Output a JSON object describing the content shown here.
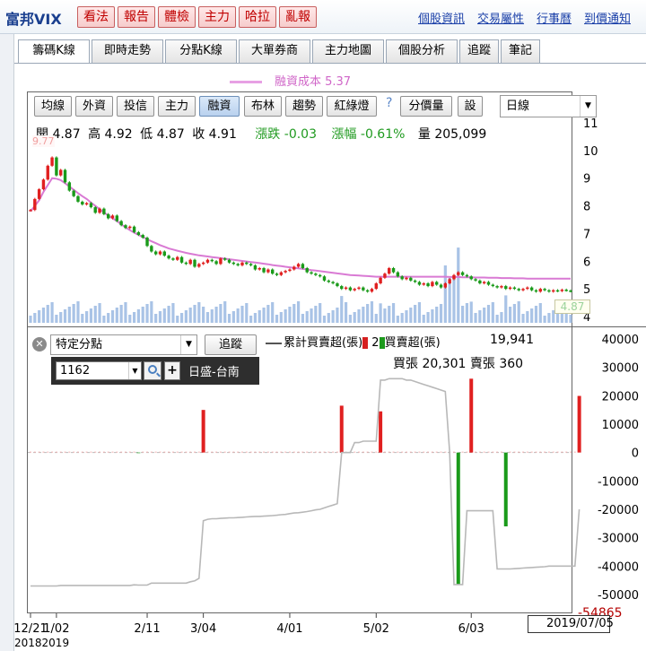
{
  "app": {
    "brand": "富邦VIX",
    "nav_buttons": [
      "看法",
      "報告",
      "體檢",
      "主力",
      "哈拉",
      "亂報"
    ],
    "nav_links": [
      "個股資訊",
      "交易屬性",
      "行事曆",
      "到價通知"
    ],
    "accent_color": "#c00000"
  },
  "tabs": [
    {
      "label": "籌碼K線",
      "active": true
    },
    {
      "label": "即時走勢",
      "active": false
    },
    {
      "label": "分點K線",
      "active": false
    },
    {
      "label": "大單券商",
      "active": false
    },
    {
      "label": "主力地圖",
      "active": false
    },
    {
      "label": "個股分析",
      "active": false
    },
    {
      "label": "追蹤",
      "active": false
    },
    {
      "label": "筆記",
      "active": false
    }
  ],
  "toolbar": {
    "buttons": [
      "均線",
      "外資",
      "投信",
      "主力",
      "融資",
      "布林",
      "趨勢",
      "紅綠燈"
    ],
    "active_button": "融資",
    "help": "?",
    "extra_buttons": [
      "分價量",
      "設"
    ],
    "period": "日線"
  },
  "legend": {
    "margin_cost": "融資成本 5.37",
    "margin_color": "#e7a0e4"
  },
  "ohlc": {
    "open": "開 4.87",
    "high": "高 4.92",
    "low": "低 4.87",
    "close": "收 4.91",
    "change": "漲跌 -0.03",
    "change_pct": "漲幅 -0.61%",
    "volume": "量 205,099"
  },
  "price_markers": {
    "high_mark": "9.77",
    "last_price": "4.87"
  },
  "broker": {
    "close_icon": "✕",
    "selector": "特定分點",
    "track_button": "追蹤",
    "code": "1162",
    "name": "日盛-台南",
    "legend_line": "累計買賣超(張)",
    "legend_bars": "買賣超(張)",
    "legend_num": "2",
    "net": "19,941",
    "buy": "買張 20,301",
    "sell": "賣張 360"
  },
  "axes": {
    "x_tick_labels": [
      "12/21",
      "1/02",
      "2/11",
      "3/04",
      "4/01",
      "5/02",
      "6/03"
    ],
    "date_box": "2019/07/05",
    "year_label": "20182019",
    "min_label": "-54865"
  },
  "chart_data": [
    {
      "type": "candlestick",
      "title": "",
      "x": [
        "2018-12-21",
        "2018-12-24",
        "2018-12-25",
        "2018-12-26",
        "2018-12-27",
        "2018-12-28",
        "2019-01-02",
        "2019-01-03",
        "2019-01-04",
        "2019-01-07",
        "2019-01-08",
        "2019-01-09",
        "2019-01-10",
        "2019-01-11",
        "2019-01-14",
        "2019-01-15",
        "2019-01-16",
        "2019-01-17",
        "2019-01-18",
        "2019-01-21",
        "2019-01-22",
        "2019-01-23",
        "2019-01-24",
        "2019-01-25",
        "2019-01-28",
        "2019-01-29",
        "2019-01-30",
        "2019-02-11",
        "2019-02-12",
        "2019-02-13",
        "2019-02-14",
        "2019-02-15",
        "2019-02-18",
        "2019-02-19",
        "2019-02-20",
        "2019-02-21",
        "2019-02-22",
        "2019-02-25",
        "2019-02-26",
        "2019-02-27",
        "2019-03-04",
        "2019-03-05",
        "2019-03-06",
        "2019-03-07",
        "2019-03-08",
        "2019-03-11",
        "2019-03-12",
        "2019-03-13",
        "2019-03-14",
        "2019-03-15",
        "2019-03-18",
        "2019-03-19",
        "2019-03-20",
        "2019-03-21",
        "2019-03-22",
        "2019-03-25",
        "2019-03-26",
        "2019-03-27",
        "2019-03-28",
        "2019-03-29",
        "2019-04-01",
        "2019-04-02",
        "2019-04-03",
        "2019-04-08",
        "2019-04-09",
        "2019-04-10",
        "2019-04-11",
        "2019-04-12",
        "2019-04-15",
        "2019-04-16",
        "2019-04-17",
        "2019-04-18",
        "2019-04-19",
        "2019-04-22",
        "2019-04-23",
        "2019-04-24",
        "2019-04-25",
        "2019-04-26",
        "2019-04-29",
        "2019-04-30",
        "2019-05-02",
        "2019-05-03",
        "2019-05-06",
        "2019-05-07",
        "2019-05-08",
        "2019-05-09",
        "2019-05-10",
        "2019-05-13",
        "2019-05-14",
        "2019-05-15",
        "2019-05-16",
        "2019-05-17",
        "2019-05-20",
        "2019-05-21",
        "2019-05-22",
        "2019-05-23",
        "2019-05-24",
        "2019-05-27",
        "2019-05-28",
        "2019-05-29",
        "2019-05-30",
        "2019-05-31",
        "2019-06-03",
        "2019-06-04",
        "2019-06-05",
        "2019-06-06",
        "2019-06-10",
        "2019-06-11",
        "2019-06-12",
        "2019-06-13",
        "2019-06-14",
        "2019-06-17",
        "2019-06-18",
        "2019-06-19",
        "2019-06-20",
        "2019-06-21",
        "2019-06-24",
        "2019-06-25",
        "2019-06-26",
        "2019-06-27",
        "2019-06-28",
        "2019-07-01",
        "2019-07-02",
        "2019-07-03",
        "2019-07-04",
        "2019-07-05"
      ],
      "close": [
        7.85,
        8.25,
        8.6,
        8.95,
        9.45,
        9.75,
        9.1,
        9.3,
        8.85,
        8.55,
        8.35,
        8.15,
        8.05,
        8.1,
        7.95,
        7.75,
        7.9,
        7.7,
        7.55,
        7.65,
        7.45,
        7.3,
        7.2,
        7.25,
        7.05,
        6.95,
        6.85,
        6.55,
        6.35,
        6.25,
        6.35,
        6.2,
        6.1,
        6.05,
        6.15,
        5.95,
        5.9,
        6.05,
        5.8,
        5.9,
        5.95,
        6.05,
        6.0,
        5.9,
        6.1,
        6.05,
        5.95,
        5.9,
        5.85,
        5.95,
        5.9,
        5.85,
        5.7,
        5.75,
        5.6,
        5.7,
        5.55,
        5.5,
        5.6,
        5.65,
        5.7,
        5.8,
        5.9,
        5.75,
        5.6,
        5.55,
        5.5,
        5.45,
        5.3,
        5.25,
        5.2,
        5.1,
        5.0,
        5.05,
        4.95,
        5.0,
        5.05,
        4.95,
        4.9,
        5.0,
        5.2,
        5.4,
        5.55,
        5.75,
        5.6,
        5.45,
        5.35,
        5.4,
        5.3,
        5.25,
        5.15,
        5.2,
        5.1,
        5.25,
        5.15,
        5.05,
        5.2,
        5.35,
        5.5,
        5.6,
        5.5,
        5.45,
        5.35,
        5.3,
        5.2,
        5.25,
        5.15,
        5.1,
        5.05,
        5.1,
        5.0,
        5.05,
        5.0,
        4.95,
        5.0,
        5.05,
        4.95,
        4.9,
        5.0,
        4.95,
        4.9,
        4.95,
        4.92,
        4.97,
        4.94,
        4.91
      ],
      "margin_cost": [
        7.8,
        8.0,
        8.2,
        8.5,
        8.75,
        9.0,
        8.98,
        8.93,
        8.82,
        8.7,
        8.58,
        8.46,
        8.35,
        8.25,
        8.12,
        8.0,
        7.88,
        7.76,
        7.65,
        7.55,
        7.45,
        7.33,
        7.22,
        7.12,
        7.03,
        6.95,
        6.87,
        6.8,
        6.72,
        6.65,
        6.58,
        6.52,
        6.46,
        6.42,
        6.38,
        6.34,
        6.3,
        6.27,
        6.24,
        6.21,
        6.19,
        6.17,
        6.15,
        6.13,
        6.11,
        6.09,
        6.07,
        6.05,
        6.03,
        6.01,
        5.99,
        5.97,
        5.95,
        5.93,
        5.91,
        5.89,
        5.86,
        5.84,
        5.82,
        5.8,
        5.78,
        5.76,
        5.74,
        5.72,
        5.7,
        5.68,
        5.66,
        5.64,
        5.62,
        5.6,
        5.58,
        5.56,
        5.54,
        5.52,
        5.5,
        5.49,
        5.48,
        5.47,
        5.46,
        5.45,
        5.44,
        5.44,
        5.44,
        5.44,
        5.44,
        5.44,
        5.44,
        5.44,
        5.44,
        5.44,
        5.44,
        5.44,
        5.44,
        5.44,
        5.44,
        5.44,
        5.44,
        5.43,
        5.43,
        5.43,
        5.42,
        5.42,
        5.42,
        5.41,
        5.41,
        5.41,
        5.4,
        5.4,
        5.4,
        5.39,
        5.39,
        5.39,
        5.38,
        5.38,
        5.38,
        5.37,
        5.37,
        5.37,
        5.37,
        5.37,
        5.37,
        5.37,
        5.37,
        5.37,
        5.37,
        5.37
      ],
      "ylim": [
        4,
        11
      ]
    },
    {
      "type": "bar",
      "title": "",
      "x_tick_labels": [
        "12/21",
        "1/02",
        "2/11",
        "3/04",
        "4/01",
        "5/02",
        "6/03"
      ],
      "net_buy_sell": [
        0,
        0,
        0,
        0,
        0,
        0,
        0,
        0,
        0,
        0,
        0,
        0,
        0,
        0,
        0,
        0,
        0,
        0,
        0,
        0,
        0,
        0,
        0,
        0,
        0,
        -200,
        0,
        0,
        0,
        0,
        0,
        0,
        0,
        0,
        0,
        0,
        0,
        0,
        0,
        0,
        15000,
        0,
        0,
        0,
        0,
        0,
        0,
        0,
        0,
        0,
        0,
        0,
        0,
        0,
        0,
        0,
        0,
        0,
        0,
        0,
        0,
        0,
        0,
        0,
        0,
        0,
        0,
        0,
        0,
        0,
        0,
        0,
        16500,
        0,
        0,
        0,
        0,
        0,
        0,
        0,
        0,
        14500,
        0,
        0,
        0,
        0,
        0,
        0,
        0,
        0,
        0,
        0,
        0,
        0,
        0,
        0,
        0,
        0,
        0,
        -46500,
        0,
        0,
        26000,
        0,
        0,
        0,
        0,
        0,
        0,
        0,
        -26000,
        0,
        0,
        0,
        0,
        0,
        0,
        0,
        0,
        0,
        0,
        0,
        0,
        0,
        0,
        0,
        0,
        19941
      ],
      "cumulative": [
        -47000,
        -47000,
        -47000,
        -47000,
        -47000,
        -47000,
        -47000,
        -46800,
        -46800,
        -46800,
        -46800,
        -46800,
        -46800,
        -46800,
        -46800,
        -46800,
        -46800,
        -46800,
        -46800,
        -46800,
        -46800,
        -46800,
        -46800,
        -46800,
        -46600,
        -46700,
        -46700,
        -46700,
        -46000,
        -46000,
        -46000,
        -46000,
        -46000,
        -46000,
        -46000,
        -46000,
        -46000,
        -45500,
        -45200,
        -44300,
        -24000,
        -23500,
        -23300,
        -23300,
        -23200,
        -23100,
        -23000,
        -23000,
        -22900,
        -22800,
        -22700,
        -22600,
        -22500,
        -22500,
        -22400,
        -22300,
        -22200,
        -22100,
        -21900,
        -21800,
        -21500,
        -21300,
        -21200,
        -21000,
        -20800,
        -20500,
        -20200,
        -20000,
        -19500,
        -19000,
        -18500,
        -18000,
        0,
        0,
        0,
        3500,
        3500,
        4000,
        4000,
        4000,
        4000,
        25500,
        25500,
        26000,
        26000,
        26000,
        26000,
        25500,
        25500,
        25000,
        24500,
        24000,
        23500,
        23000,
        22500,
        22000,
        21500,
        0,
        -46500,
        -46500,
        -46500,
        -20500,
        -20500,
        -20500,
        -20500,
        -20500,
        -20500,
        -20500,
        -41000,
        -41000,
        -41000,
        -41000,
        -40900,
        -40800,
        -40700,
        -40600,
        -40500,
        -40400,
        -40300,
        -40200,
        -40000,
        -40000,
        -40000,
        -40000,
        -40000,
        -40000,
        -40000,
        -20000
      ],
      "ylim": [
        -54865,
        40000
      ],
      "y_ticks": [
        40000,
        30000,
        20000,
        10000,
        0,
        -10000,
        -20000,
        -30000,
        -40000,
        -50000
      ]
    }
  ]
}
